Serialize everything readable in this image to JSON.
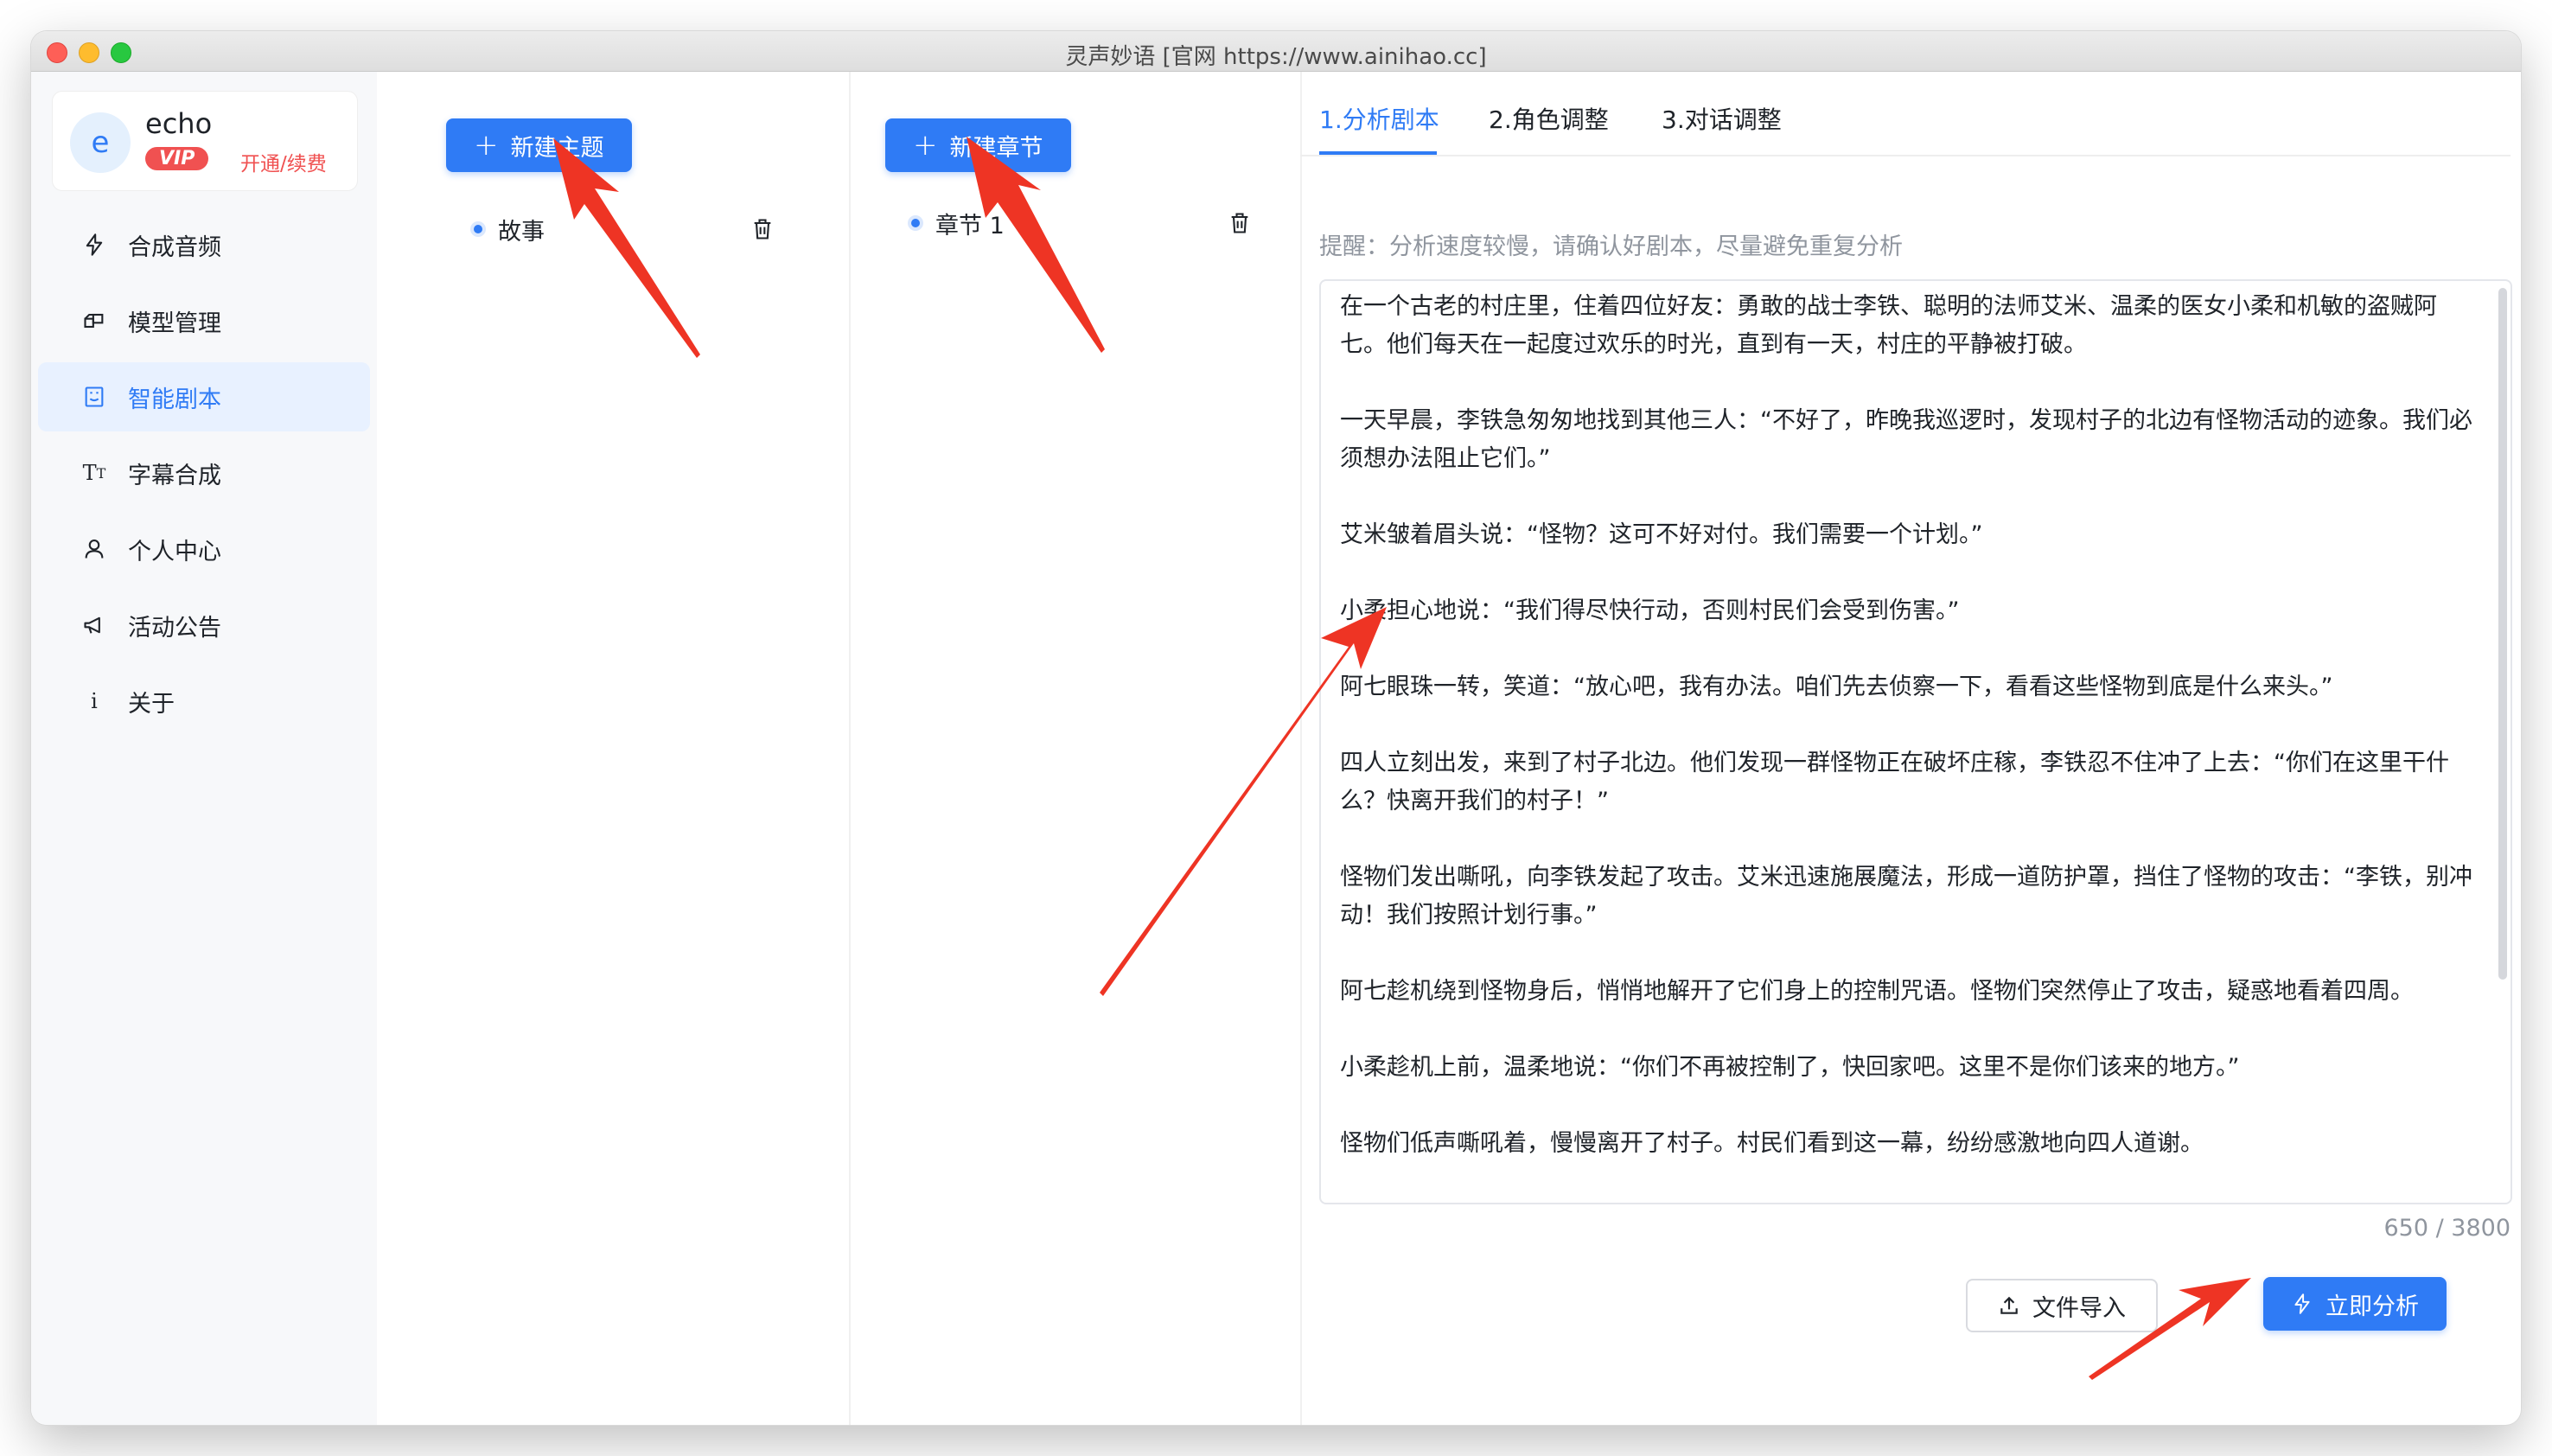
{
  "window": {
    "title": "灵声妙语 [官网 https://www.ainihao.cc]"
  },
  "user": {
    "avatar_letter": "e",
    "name": "echo",
    "vip_label": "VIP",
    "renew_label": "开通/续费"
  },
  "sidebar": {
    "items": [
      {
        "label": "合成音频",
        "icon": "lightning-icon",
        "active": false
      },
      {
        "label": "模型管理",
        "icon": "model-icon",
        "active": false
      },
      {
        "label": "智能剧本",
        "icon": "script-icon",
        "active": true
      },
      {
        "label": "字幕合成",
        "icon": "text-icon",
        "active": false
      },
      {
        "label": "个人中心",
        "icon": "user-icon",
        "active": false
      },
      {
        "label": "活动公告",
        "icon": "megaphone-icon",
        "active": false
      },
      {
        "label": "关于",
        "icon": "info-icon",
        "active": false
      }
    ]
  },
  "topics": {
    "new_label": "新建主题",
    "items": [
      {
        "label": "故事"
      }
    ]
  },
  "chapters": {
    "new_label": "新建章节",
    "items": [
      {
        "label": "章节 1"
      }
    ]
  },
  "tabs": [
    {
      "label": "1.分析剧本",
      "active": true
    },
    {
      "label": "2.角色调整",
      "active": false
    },
    {
      "label": "3.对话调整",
      "active": false
    }
  ],
  "hint": "提醒：分析速度较慢，请确认好剧本，尽量避免重复分析",
  "editor": {
    "paragraphs": [
      "在一个古老的村庄里，住着四位好友：勇敢的战士李铁、聪明的法师艾米、温柔的医女小柔和机敏的盗贼阿七。他们每天在一起度过欢乐的时光，直到有一天，村庄的平静被打破。",
      "一天早晨，李铁急匆匆地找到其他三人：“不好了，昨晚我巡逻时，发现村子的北边有怪物活动的迹象。我们必须想办法阻止它们。”",
      "艾米皱着眉头说：“怪物？这可不好对付。我们需要一个计划。”",
      "小柔担心地说：“我们得尽快行动，否则村民们会受到伤害。”",
      "阿七眼珠一转，笑道：“放心吧，我有办法。咱们先去侦察一下，看看这些怪物到底是什么来头。”",
      "四人立刻出发，来到了村子北边。他们发现一群怪物正在破坏庄稼，李铁忍不住冲了上去：“你们在这里干什么？快离开我们的村子！”",
      "怪物们发出嘶吼，向李铁发起了攻击。艾米迅速施展魔法，形成一道防护罩，挡住了怪物的攻击：“李铁，别冲动！我们按照计划行事。”",
      "阿七趁机绕到怪物身后，悄悄地解开了它们身上的控制咒语。怪物们突然停止了攻击，疑惑地看着四周。",
      "小柔趁机上前，温柔地说：“你们不再被控制了，快回家吧。这里不是你们该来的地方。”",
      "怪物们低声嘶吼着，慢慢离开了村子。村民们看到这一幕，纷纷感激地向四人道谢。"
    ],
    "char_count": "650 / 3800"
  },
  "buttons": {
    "import_label": "文件导入",
    "analyze_label": "立即分析"
  },
  "colors": {
    "primary": "#2f7bf5",
    "vip": "#f05151",
    "annotation_arrow": "#ee3424"
  }
}
